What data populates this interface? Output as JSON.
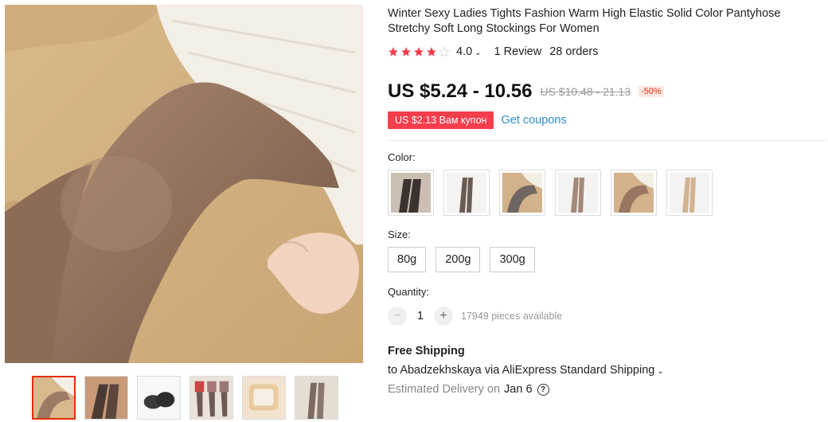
{
  "product": {
    "title": "Winter Sexy Ladies Tights Fashion Warm High Elastic Solid Color Pantyhose Stretchy Soft Long Stockings For Women",
    "rating": {
      "stars": 4.0,
      "value_label": "4.0",
      "reviews_label": "1 Review",
      "orders_label": "28 orders"
    },
    "price": {
      "current": "US $5.24 - 10.56",
      "original": "US $10.48 - 21.13",
      "discount": "-50%"
    },
    "coupon": {
      "badge": "US $2.13 Вам купон",
      "link": "Get coupons"
    },
    "color": {
      "label": "Color:",
      "swatch_count": 6
    },
    "size": {
      "label": "Size:",
      "options": [
        "80g",
        "200g",
        "300g"
      ]
    },
    "quantity": {
      "label": "Quantity:",
      "value": "1",
      "minus": "−",
      "plus": "+",
      "available": "17949 pieces available"
    },
    "shipping": {
      "title": "Free Shipping",
      "line": "to Abadzekhskaya via AliExpress Standard Shipping",
      "delivery_prefix": "Estimated Delivery on",
      "delivery_date": "Jan 6",
      "help_icon": "?"
    }
  },
  "colors": {
    "accent": "#e62e04",
    "coupon": "#f53d4c",
    "link": "#2f8ecf",
    "star": "#f53d4c"
  }
}
